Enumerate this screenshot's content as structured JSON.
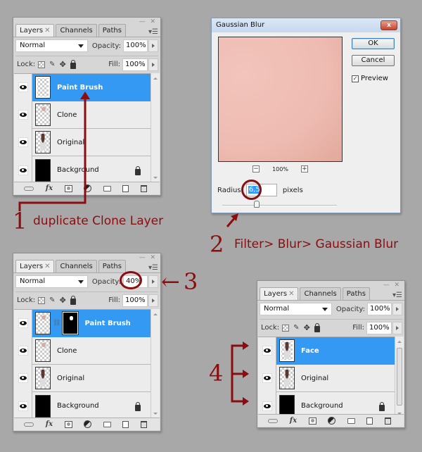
{
  "panels": [
    {
      "id": "panel1",
      "tabs": [
        "Layers",
        "Channels",
        "Paths"
      ],
      "active_tab": "Layers",
      "blend_mode": "Normal",
      "opacity_label": "Opacity:",
      "opacity": "100%",
      "lock_label": "Lock:",
      "fill_label": "Fill:",
      "fill": "100%",
      "layers": [
        {
          "name": "Paint Brush",
          "selected": true,
          "thumb": "transparent"
        },
        {
          "name": "Clone",
          "selected": false,
          "thumb": "spot"
        },
        {
          "name": "Original",
          "selected": false,
          "thumb": "photo"
        },
        {
          "name": "Background",
          "selected": false,
          "thumb": "black",
          "locked": true
        }
      ]
    },
    {
      "id": "panel2",
      "tabs": [
        "Layers",
        "Channels",
        "Paths"
      ],
      "active_tab": "Layers",
      "blend_mode": "Normal",
      "opacity_label": "Opacity:",
      "opacity": "40%",
      "lock_label": "Lock:",
      "fill_label": "Fill:",
      "fill": "100%",
      "layers": [
        {
          "name": "Paint Brush",
          "selected": true,
          "thumb": "spot",
          "mask": true
        },
        {
          "name": "Clone",
          "selected": false,
          "thumb": "spot"
        },
        {
          "name": "Original",
          "selected": false,
          "thumb": "photo"
        },
        {
          "name": "Background",
          "selected": false,
          "thumb": "black",
          "locked": true
        }
      ]
    },
    {
      "id": "panel3",
      "tabs": [
        "Layers",
        "Channels",
        "Paths"
      ],
      "active_tab": "Layers",
      "blend_mode": "Normal",
      "opacity_label": "Opacity:",
      "opacity": "100%",
      "lock_label": "Lock:",
      "fill_label": "Fill:",
      "fill": "100%",
      "layers": [
        {
          "name": "Face",
          "selected": true,
          "thumb": "photo"
        },
        {
          "name": "Original",
          "selected": false,
          "thumb": "photo"
        },
        {
          "name": "Background",
          "selected": false,
          "thumb": "black",
          "locked": true
        }
      ]
    }
  ],
  "dialog": {
    "title": "Gaussian Blur",
    "close_label": "x",
    "ok_label": "OK",
    "cancel_label": "Cancel",
    "preview_label": "Preview",
    "preview_checked": true,
    "zoom_minus": "−",
    "zoom_level": "100%",
    "zoom_plus": "+",
    "radius_label": "Radius:",
    "radius_value": "6,5",
    "radius_unit": "pixels",
    "slider_value_fraction": 0.3
  },
  "annotations": {
    "step1_num": "1",
    "step1_text": "duplicate Clone Layer",
    "step2_num": "2",
    "step2_text": "Filter> Blur> Gaussian Blur",
    "step3_num": "3",
    "step3_arrow": "←",
    "step4_num": "4",
    "color": "#8b0d10"
  },
  "colors": {
    "selection": "#3399f3",
    "background": "#a8a8a8",
    "panel": "#d6d6d6"
  }
}
